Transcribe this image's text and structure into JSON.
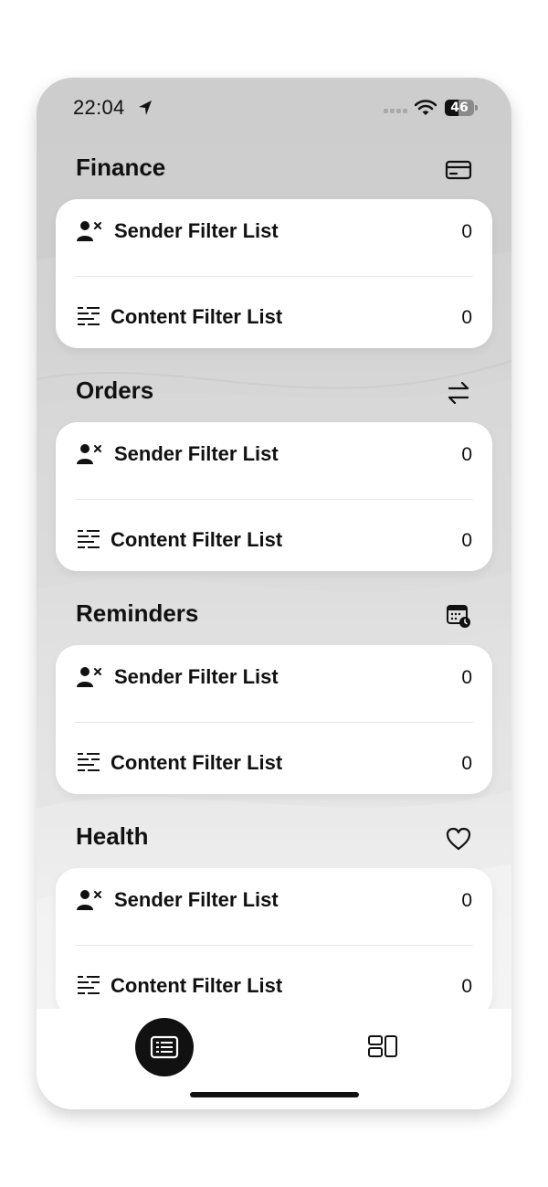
{
  "status_bar": {
    "time": "22:04",
    "battery_level": "46",
    "battery_fraction": 0.46,
    "icons": [
      "location-arrow-icon",
      "cellular-signal-icon",
      "wifi-icon",
      "battery-icon"
    ]
  },
  "sections": [
    {
      "title": "Finance",
      "icon": "credit-card-icon",
      "rows": [
        {
          "label": "Sender Filter List",
          "count": "0",
          "icon": "person-block-icon"
        },
        {
          "label": "Content Filter List",
          "count": "0",
          "icon": "text-filter-icon"
        }
      ]
    },
    {
      "title": "Orders",
      "icon": "arrows-swap-icon",
      "rows": [
        {
          "label": "Sender Filter List",
          "count": "0",
          "icon": "person-block-icon"
        },
        {
          "label": "Content Filter List",
          "count": "0",
          "icon": "text-filter-icon"
        }
      ]
    },
    {
      "title": "Reminders",
      "icon": "calendar-clock-icon",
      "rows": [
        {
          "label": "Sender Filter List",
          "count": "0",
          "icon": "person-block-icon"
        },
        {
          "label": "Content Filter List",
          "count": "0",
          "icon": "text-filter-icon"
        }
      ]
    },
    {
      "title": "Health",
      "icon": "heart-icon",
      "rows": [
        {
          "label": "Sender Filter List",
          "count": "0",
          "icon": "person-block-icon"
        },
        {
          "label": "Content Filter List",
          "count": "0",
          "icon": "text-filter-icon"
        }
      ]
    }
  ],
  "tab_bar": {
    "tabs": [
      {
        "icon": "list-icon",
        "active": true
      },
      {
        "icon": "widgets-icon",
        "active": false
      }
    ]
  },
  "colors": {
    "accent": "#111111",
    "card": "#ffffff",
    "background_top": "#cfcfcf",
    "background_bottom": "#fafafa"
  }
}
